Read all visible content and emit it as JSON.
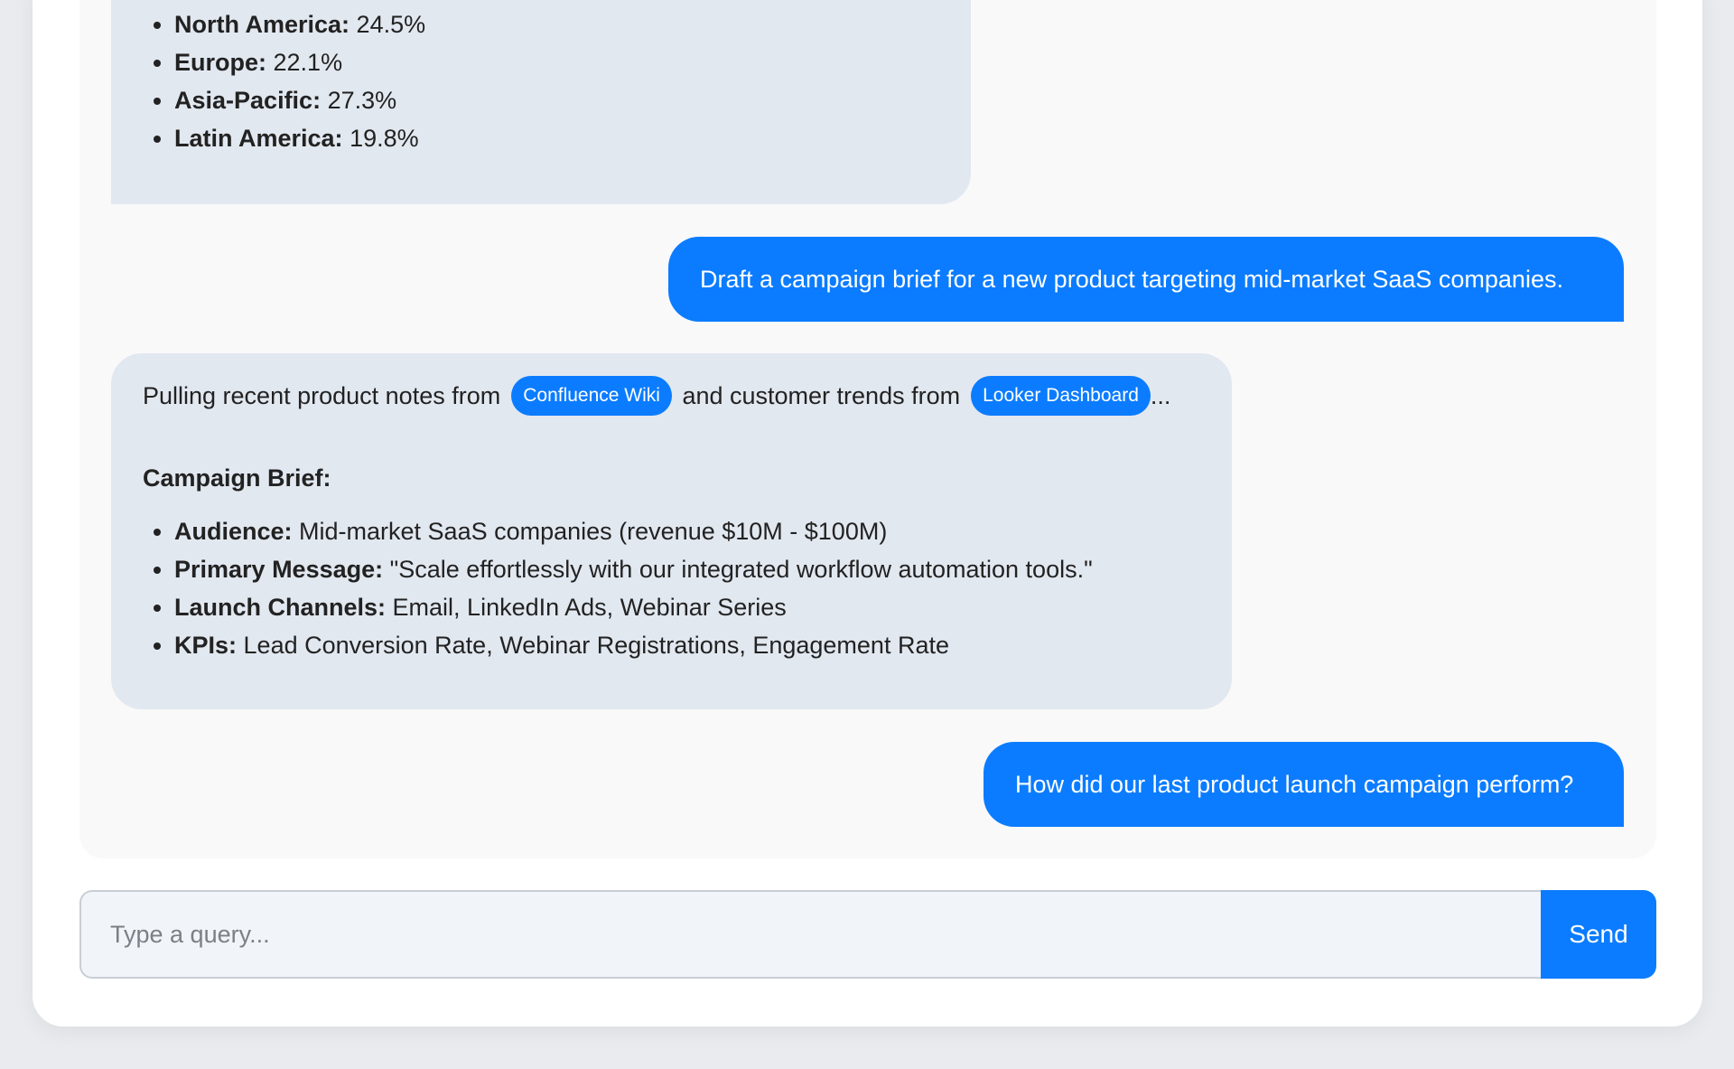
{
  "messages": {
    "assistant_regions": {
      "items": [
        {
          "label": "North America:",
          "value": " 24.5%"
        },
        {
          "label": "Europe:",
          "value": " 22.1%"
        },
        {
          "label": "Asia-Pacific:",
          "value": " 27.3%"
        },
        {
          "label": "Latin America:",
          "value": " 19.8%"
        }
      ]
    },
    "user_campaign_request": "Draft a campaign brief for a new product targeting mid-market SaaS companies.",
    "assistant_brief": {
      "intro_prefix": "Pulling recent product notes from",
      "source_one": "Confluence Wiki",
      "intro_middle": "and customer trends from",
      "source_two": "Looker Dashboard",
      "intro_suffix": "...",
      "heading": "Campaign Brief:",
      "items": [
        {
          "label": "Audience:",
          "value": " Mid-market SaaS companies (revenue $10M - $100M)"
        },
        {
          "label": "Primary Message:",
          "value": " \"Scale effortlessly with our integrated workflow automation tools.\""
        },
        {
          "label": "Launch Channels:",
          "value": " Email, LinkedIn Ads, Webinar Series"
        },
        {
          "label": "KPIs:",
          "value": " Lead Conversion Rate, Webinar Registrations, Engagement Rate"
        }
      ]
    },
    "user_last_campaign": "How did our last product launch campaign perform?"
  },
  "composer": {
    "placeholder": "Type a query...",
    "send_label": "Send"
  }
}
